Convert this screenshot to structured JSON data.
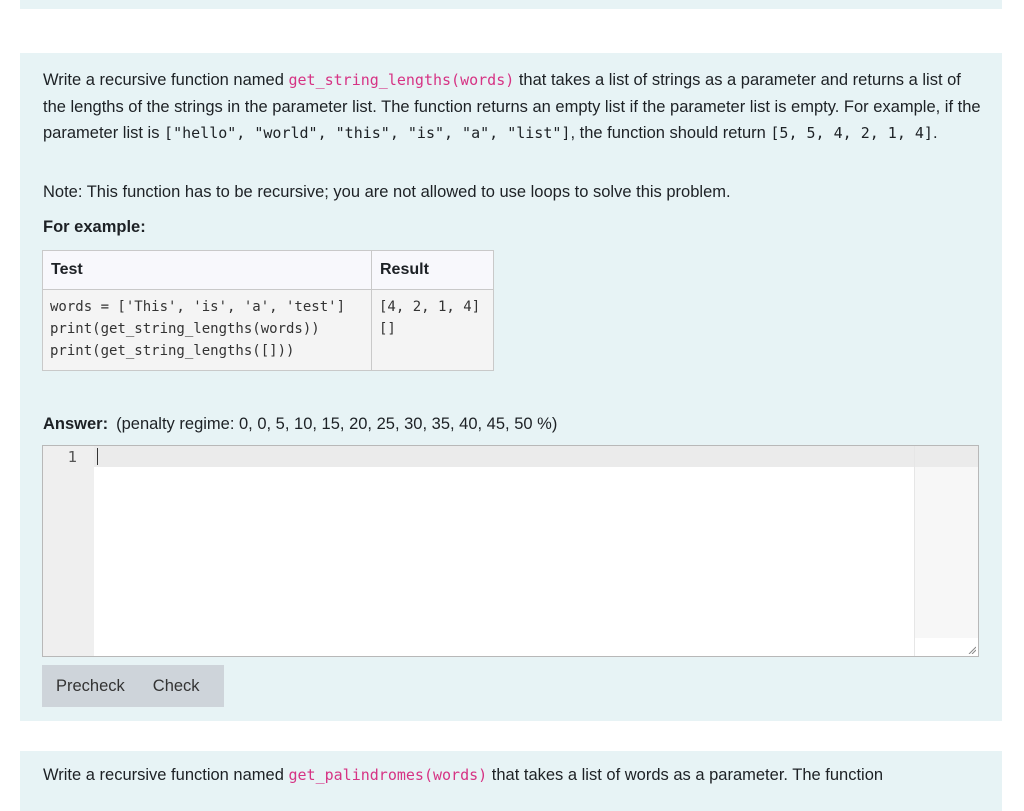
{
  "question1": {
    "intro_prefix": "Write a recursive function named ",
    "function_signature": "get_string_lengths(words)",
    "intro_rest": " that takes a list of strings as a parameter and returns a list of the lengths of the strings in the parameter list. The function returns an empty list if the parameter list is empty. For example, if the parameter list is ",
    "example_list": "[\"hello\", \"world\", \"this\", \"is\", \"a\", \"list\"]",
    "mid_text": ", the function should return ",
    "example_result": "[5, 5, 4, 2, 1, 4]",
    "end_text": ".",
    "note": "Note: This function has to be recursive; you are not allowed to use loops to solve this problem.",
    "for_example_label": "For example:",
    "table": {
      "headers": [
        "Test",
        "Result"
      ],
      "rows": [
        {
          "test": "words = ['This', 'is', 'a', 'test']\nprint(get_string_lengths(words))\nprint(get_string_lengths([]))",
          "result": "[4, 2, 1, 4]\n[]"
        }
      ]
    },
    "answer_label": "Answer:",
    "penalty_regime": "(penalty regime: 0, 0, 5, 10, 15, 20, 25, 30, 35, 40, 45, 50 %)",
    "editor": {
      "line_number": "1",
      "content": ""
    },
    "buttons": {
      "precheck": "Precheck",
      "check": "Check"
    }
  },
  "question2": {
    "intro_prefix": "Write a recursive function named ",
    "function_signature": "get_palindromes(words)",
    "intro_rest": " that takes a list of words as a parameter. The function"
  }
}
